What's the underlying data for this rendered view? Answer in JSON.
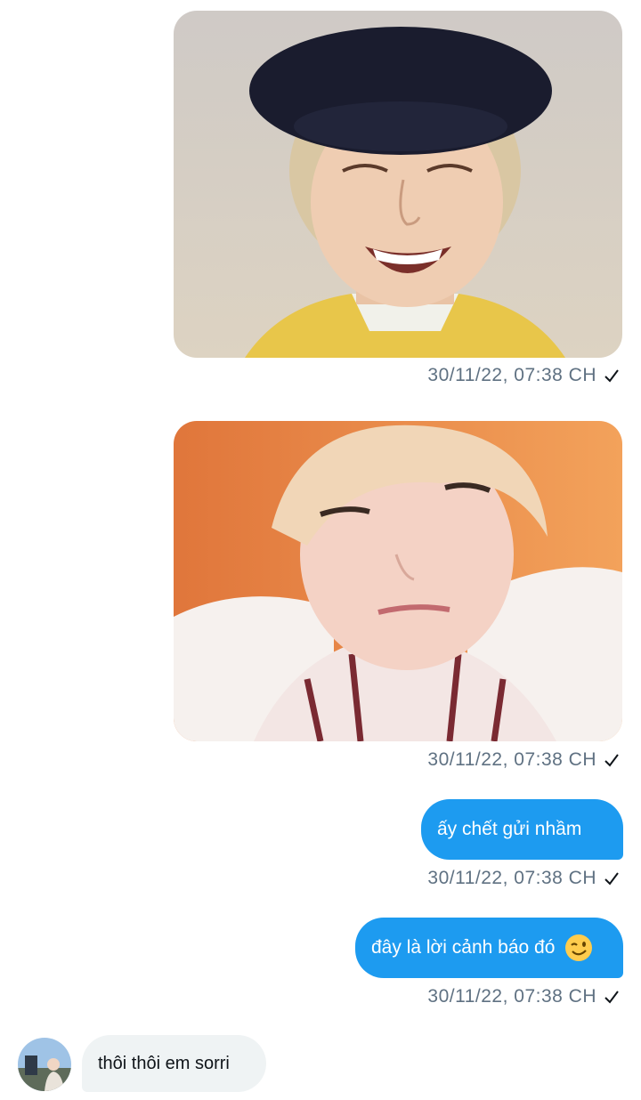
{
  "colors": {
    "outgoing_bubble": "#1d9bf0",
    "incoming_bubble": "#eff3f4",
    "meta_text": "#5f7182"
  },
  "messages": [
    {
      "type": "image",
      "direction": "outgoing",
      "image_alt": "photo of a laughing person wearing a black beret and yellow shirt",
      "timestamp": "30/11/22, 07:38 CH",
      "status_icon": "sent-check-icon"
    },
    {
      "type": "image",
      "direction": "outgoing",
      "image_alt": "close-up photo of a blond person squinting, lying on a pillow",
      "timestamp": "30/11/22, 07:38 CH",
      "status_icon": "sent-check-icon"
    },
    {
      "type": "text",
      "direction": "outgoing",
      "text": "ấy chết gửi nhầm",
      "timestamp": "30/11/22, 07:38 CH",
      "status_icon": "sent-check-icon"
    },
    {
      "type": "text",
      "direction": "outgoing",
      "text": "đây là lời cảnh báo đó",
      "emoji": "winking-face-emoji",
      "timestamp": "30/11/22, 07:38 CH",
      "status_icon": "sent-check-icon"
    },
    {
      "type": "text",
      "direction": "incoming",
      "text": "thôi thôi em sorri",
      "avatar": "contact-avatar"
    }
  ]
}
